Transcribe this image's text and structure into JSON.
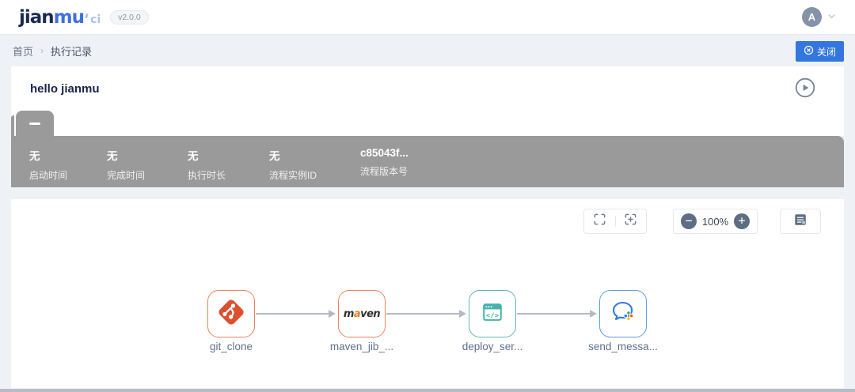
{
  "header": {
    "logo_part1": "jian",
    "logo_part2": "mu",
    "logo_sub": "ci",
    "version_badge": "v2.0.0",
    "avatar_letter": "A"
  },
  "breadcrumb": {
    "home": "首页",
    "separator": "›",
    "current": "执行记录"
  },
  "actions": {
    "close_label": "关闭"
  },
  "pipeline": {
    "title": "hello jianmu"
  },
  "info_bar": {
    "fields": [
      {
        "value": "无",
        "label": "启动时间"
      },
      {
        "value": "无",
        "label": "完成时间"
      },
      {
        "value": "无",
        "label": "执行时长"
      },
      {
        "value": "无",
        "label": "流程实例ID"
      },
      {
        "value": "c85043f...",
        "label": "流程版本号"
      }
    ]
  },
  "canvas": {
    "zoom_level": "100%",
    "zoom_out_symbol": "−",
    "zoom_in_symbol": "+",
    "nodes": [
      {
        "label": "git_clone",
        "icon": "git-icon",
        "border_color": "#f0835e"
      },
      {
        "label": "maven_jib_...",
        "icon": "maven-logo",
        "border_color": "#f0835e",
        "icon_text_parts": [
          "m",
          "a",
          "ven"
        ]
      },
      {
        "label": "deploy_ser...",
        "icon": "code-window-icon",
        "border_color": "#5cb9b1"
      },
      {
        "label": "send_messa...",
        "icon": "wecom-chat-icon",
        "border_color": "#5f9cf0"
      }
    ]
  },
  "colors": {
    "primary_blue": "#3476e0",
    "info_bar_gray": "#9a9a9a",
    "page_bg": "#eef1f6",
    "node_orange": "#f0835e",
    "node_teal": "#5cb9b1",
    "node_blue": "#5f9cf0"
  }
}
